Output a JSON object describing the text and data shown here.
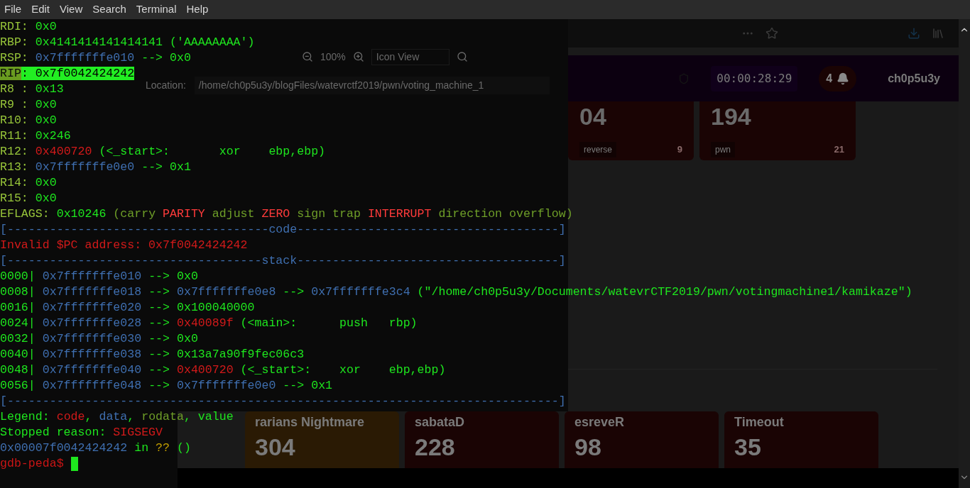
{
  "menu": [
    "File",
    "Edit",
    "View",
    "Search",
    "Terminal",
    "Help"
  ],
  "file_manager": {
    "zoom": "100%",
    "view": "Icon View",
    "location_label": "Location:",
    "location": "/home/ch0p5u3y/blogFiles/watevrctf2019/pwn/voting_machine_1"
  },
  "browser": {
    "timer": "00:00:28:29",
    "notifications": "4",
    "username": "ch0p5u3y",
    "top_cards": [
      {
        "score": "04",
        "tags": [
          "reverse"
        ],
        "count": "9",
        "color": "#1a0404"
      },
      {
        "score": "194",
        "tags": [
          "pwn"
        ],
        "count": "21",
        "color": "#1a0404"
      }
    ],
    "bottom_cards": [
      {
        "title": "rarians Nightmare",
        "score": "304",
        "color": "#2a1a04"
      },
      {
        "title": "sabataD",
        "score": "228",
        "color": "#1a0404"
      },
      {
        "title": "esreveR",
        "score": "98",
        "color": "#1a0404"
      },
      {
        "title": "Timeout",
        "score": "35",
        "color": "#1a0404"
      }
    ]
  },
  "terminal": {
    "lines": [
      {
        "segments": [
          {
            "kind": "label",
            "text": "RDI: "
          },
          {
            "kind": "value",
            "text": "0x0"
          }
        ]
      },
      {
        "segments": [
          {
            "kind": "label",
            "text": "RBP: "
          },
          {
            "kind": "value",
            "text": "0x4141414141414141 ('AAAAAAAA')"
          }
        ]
      },
      {
        "segments": [
          {
            "kind": "label",
            "text": "RSP: "
          },
          {
            "kind": "address",
            "text": "0x7fffffffe010"
          },
          {
            "kind": "value",
            "text": " --> 0x0"
          }
        ]
      },
      {
        "segments": [
          {
            "kind": "highlight_label",
            "text": "RIP"
          },
          {
            "kind": "highlight_value",
            "text": ": 0x7f0042424242"
          }
        ]
      },
      {
        "segments": [
          {
            "kind": "label",
            "text": "R8 : "
          },
          {
            "kind": "value",
            "text": "0x13"
          }
        ]
      },
      {
        "segments": [
          {
            "kind": "label",
            "text": "R9 : "
          },
          {
            "kind": "value",
            "text": "0x0"
          }
        ]
      },
      {
        "segments": [
          {
            "kind": "label",
            "text": "R10: "
          },
          {
            "kind": "value",
            "text": "0x0"
          }
        ]
      },
      {
        "segments": [
          {
            "kind": "label",
            "text": "R11: "
          },
          {
            "kind": "value",
            "text": "0x246"
          }
        ]
      },
      {
        "segments": [
          {
            "kind": "label",
            "text": "R12: "
          },
          {
            "kind": "code",
            "text": "0x400720"
          },
          {
            "kind": "value",
            "text": " (<_start>:       xor    ebp,ebp)"
          }
        ]
      },
      {
        "segments": [
          {
            "kind": "label",
            "text": "R13: "
          },
          {
            "kind": "address",
            "text": "0x7fffffffe0e0"
          },
          {
            "kind": "value",
            "text": " --> 0x1"
          }
        ]
      },
      {
        "segments": [
          {
            "kind": "label",
            "text": "R14: "
          },
          {
            "kind": "value",
            "text": "0x0"
          }
        ]
      },
      {
        "segments": [
          {
            "kind": "label",
            "text": "R15: "
          },
          {
            "kind": "value",
            "text": "0x0"
          }
        ]
      },
      {
        "segments": [
          {
            "kind": "label",
            "text": "EFLAGS: "
          },
          {
            "kind": "value",
            "text": "0x10246"
          },
          {
            "kind": "rodata",
            "text": " (carry "
          },
          {
            "kind": "flag_set",
            "text": "PARITY"
          },
          {
            "kind": "rodata",
            "text": " adjust "
          },
          {
            "kind": "flag_set",
            "text": "ZERO"
          },
          {
            "kind": "rodata",
            "text": " sign trap "
          },
          {
            "kind": "flag_set",
            "text": "INTERRUPT"
          },
          {
            "kind": "rodata",
            "text": " direction overflow)"
          }
        ]
      },
      {
        "segments": [
          {
            "kind": "address",
            "text": "[-------------------------------------code-------------------------------------]"
          }
        ]
      },
      {
        "segments": [
          {
            "kind": "code",
            "text": "Invalid $PC address: 0x7f0042424242"
          }
        ]
      },
      {
        "segments": [
          {
            "kind": "address",
            "text": "[------------------------------------stack-------------------------------------]"
          }
        ]
      },
      {
        "segments": [
          {
            "kind": "value",
            "text": "0000| "
          },
          {
            "kind": "address",
            "text": "0x7fffffffe010"
          },
          {
            "kind": "value",
            "text": " --> 0x0"
          }
        ]
      },
      {
        "segments": [
          {
            "kind": "value",
            "text": "0008| "
          },
          {
            "kind": "address",
            "text": "0x7fffffffe018"
          },
          {
            "kind": "value",
            "text": " --> "
          },
          {
            "kind": "address",
            "text": "0x7fffffffe0e8"
          },
          {
            "kind": "value",
            "text": " --> "
          },
          {
            "kind": "address",
            "text": "0x7fffffffe3c4"
          },
          {
            "kind": "value",
            "text": " (\"/home/ch0p5u3y/Documents/watevrCTF2019/pwn/votingmachine1/kamikaze\")"
          }
        ]
      },
      {
        "segments": [
          {
            "kind": "value",
            "text": "0016| "
          },
          {
            "kind": "address",
            "text": "0x7fffffffe020"
          },
          {
            "kind": "value",
            "text": " --> 0x100040000"
          }
        ]
      },
      {
        "segments": [
          {
            "kind": "value",
            "text": "0024| "
          },
          {
            "kind": "address",
            "text": "0x7fffffffe028"
          },
          {
            "kind": "value",
            "text": " --> "
          },
          {
            "kind": "code",
            "text": "0x40089f"
          },
          {
            "kind": "value",
            "text": " (<main>:      push   rbp)"
          }
        ]
      },
      {
        "segments": [
          {
            "kind": "value",
            "text": "0032| "
          },
          {
            "kind": "address",
            "text": "0x7fffffffe030"
          },
          {
            "kind": "value",
            "text": " --> 0x0"
          }
        ]
      },
      {
        "segments": [
          {
            "kind": "value",
            "text": "0040| "
          },
          {
            "kind": "address",
            "text": "0x7fffffffe038"
          },
          {
            "kind": "value",
            "text": " --> 0x13a7a90f9fec06c3"
          }
        ]
      },
      {
        "segments": [
          {
            "kind": "value",
            "text": "0048| "
          },
          {
            "kind": "address",
            "text": "0x7fffffffe040"
          },
          {
            "kind": "value",
            "text": " --> "
          },
          {
            "kind": "code",
            "text": "0x400720"
          },
          {
            "kind": "value",
            "text": " (<_start>:    xor    ebp,ebp)"
          }
        ]
      },
      {
        "segments": [
          {
            "kind": "value",
            "text": "0056| "
          },
          {
            "kind": "address",
            "text": "0x7fffffffe048"
          },
          {
            "kind": "value",
            "text": " --> "
          },
          {
            "kind": "address",
            "text": "0x7fffffffe0e0"
          },
          {
            "kind": "value",
            "text": " --> 0x1"
          }
        ]
      },
      {
        "segments": [
          {
            "kind": "address",
            "text": "[------------------------------------------------------------------------------]"
          }
        ]
      },
      {
        "segments": [
          {
            "kind": "value",
            "text": "Legend: "
          },
          {
            "kind": "code",
            "text": "code"
          },
          {
            "kind": "value",
            "text": ", "
          },
          {
            "kind": "address",
            "text": "data"
          },
          {
            "kind": "value",
            "text": ", "
          },
          {
            "kind": "rodata",
            "text": "rodata"
          },
          {
            "kind": "value",
            "text": ", value"
          }
        ]
      },
      {
        "segments": [
          {
            "kind": "value",
            "text": "Stopped reason: "
          },
          {
            "kind": "code",
            "text": "SIGSEGV"
          }
        ]
      },
      {
        "segments": [
          {
            "kind": "address",
            "text": "0x00007f0042424242"
          },
          {
            "kind": "value",
            "text": " in "
          },
          {
            "kind": "question",
            "text": "??"
          },
          {
            "kind": "value",
            "text": " ()"
          }
        ]
      },
      {
        "segments": [
          {
            "kind": "prompt",
            "text": "gdb-peda$ "
          }
        ],
        "cursor": true
      }
    ]
  }
}
